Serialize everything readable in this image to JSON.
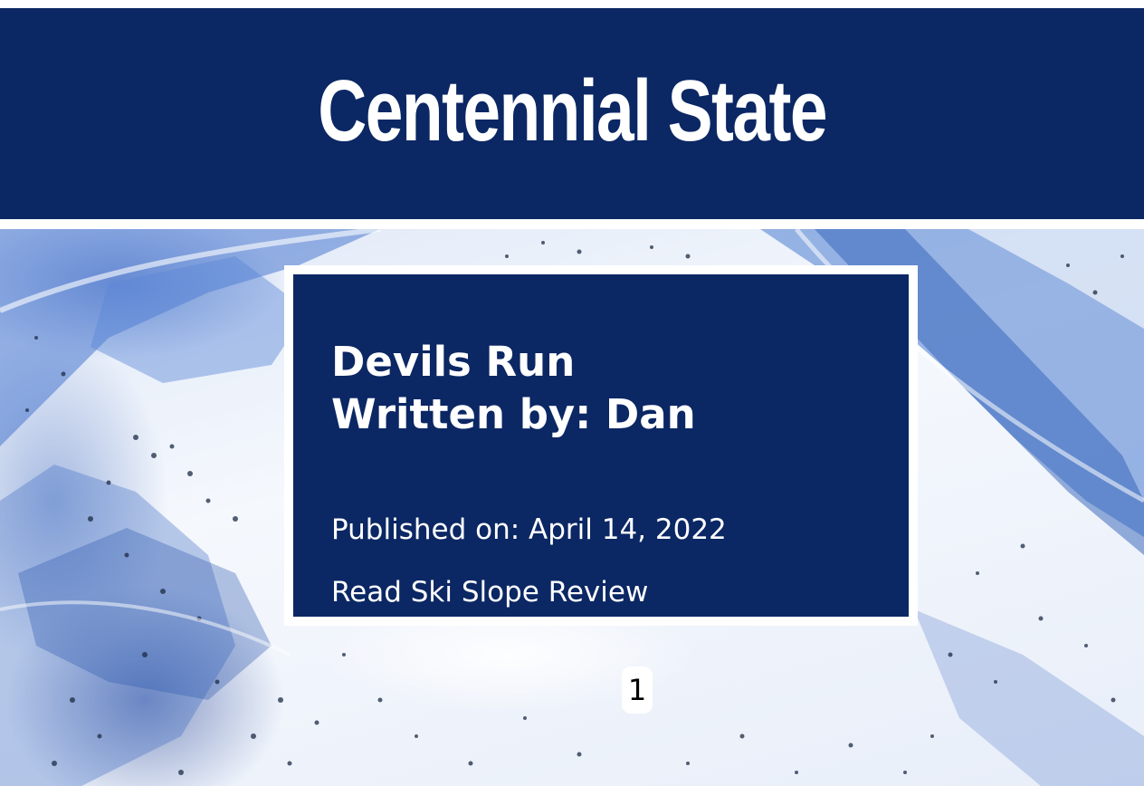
{
  "header": {
    "title": "Centennial State"
  },
  "card": {
    "title": "Devils Run",
    "author_line": "Written by: Dan",
    "published": "Published on: April 14, 2022",
    "link_label": "Read Ski Slope Review"
  },
  "pagination": {
    "current_page": "1"
  },
  "colors": {
    "brand_navy": "#0b2764",
    "text_light": "#ffffff",
    "snow_shadow": "#3f6dc4"
  }
}
